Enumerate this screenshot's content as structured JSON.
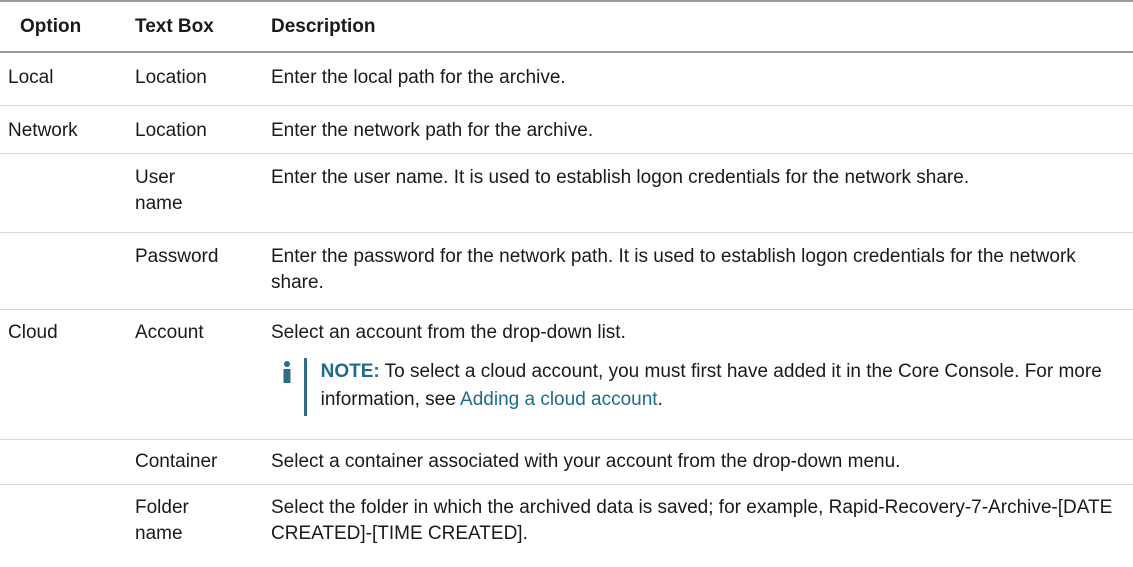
{
  "headers": [
    "Option",
    "Text Box",
    "Description"
  ],
  "rows": [
    {
      "option": "Local",
      "textbox": "Location",
      "description": "Enter the local path for the archive."
    },
    {
      "option": "Network",
      "textbox": "Location",
      "description": "Enter the network path for the archive."
    },
    {
      "option": "",
      "textbox_line1": "User",
      "textbox_line2": "name",
      "description": "Enter the user name. It is used to establish logon credentials for the network share."
    },
    {
      "option": "",
      "textbox": "Password",
      "description": "Enter the password for the network path. It is used to establish logon credentials for the network share."
    },
    {
      "option": "Cloud",
      "textbox": "Account",
      "description": "Select an account from the drop-down list.",
      "note": {
        "label": "NOTE:",
        "text": "To select a cloud account, you must first have added it in the Core Console. For more information, see",
        "link": "Adding a cloud account",
        "after": "."
      }
    },
    {
      "option": "",
      "textbox": "Container",
      "description": "Select a container associated with your account from the drop-down menu."
    },
    {
      "option": "",
      "textbox_line1": "Folder",
      "textbox_line2": "name",
      "description": "Select the folder in which the archived data is saved; for example, Rapid-Recovery-7-Archive-[DATE CREATED]-[TIME CREATED]."
    }
  ],
  "icons": {
    "note": "info-icon"
  },
  "colors": {
    "accent": "#1f6b8a",
    "rule": "#9a9a9a",
    "divider": "#d8d8d8"
  }
}
